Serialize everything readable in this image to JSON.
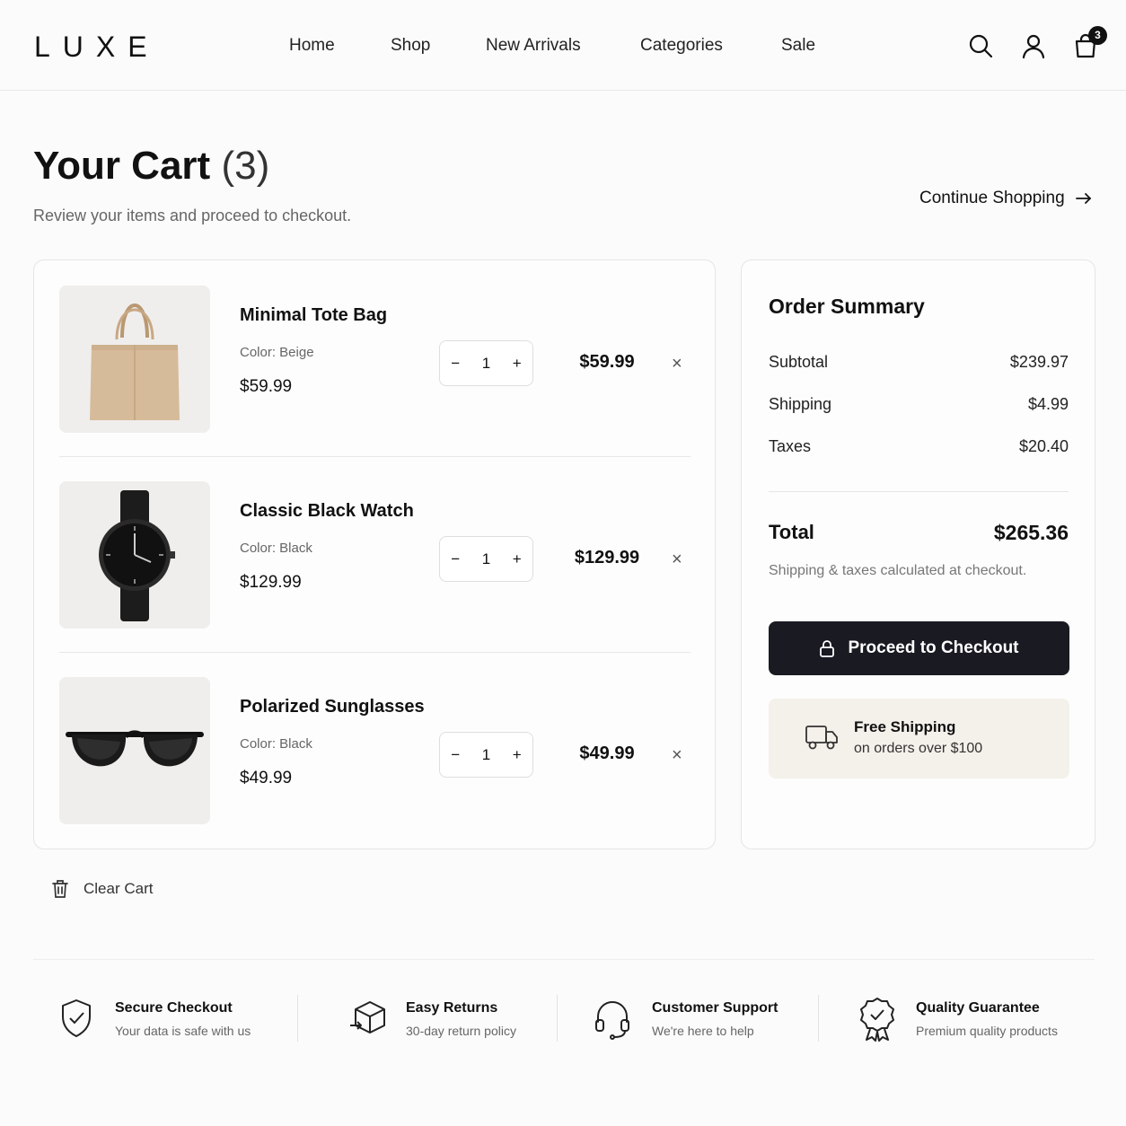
{
  "brand": {
    "logo": "LUXE"
  },
  "nav": {
    "items": [
      "Home",
      "Shop",
      "New Arrivals",
      "Categories",
      "Sale"
    ]
  },
  "header": {
    "cart_count": "3",
    "icons": [
      "search-icon",
      "user-icon",
      "shopping-bag-icon"
    ]
  },
  "page": {
    "title": "Your Cart",
    "title_count": "(3)",
    "subtitle": "Review your items and proceed to checkout.",
    "continue_label": "Continue Shopping"
  },
  "cart": {
    "items": [
      {
        "name": "Minimal Tote Bag",
        "color": "Color: Beige",
        "price": "$59.99",
        "qty": "1",
        "total": "$59.99",
        "image": "tote-bag-image"
      },
      {
        "name": "Classic Black Watch",
        "color": "Color: Black",
        "price": "$129.99",
        "qty": "1",
        "total": "$129.99",
        "image": "watch-image"
      },
      {
        "name": "Polarized Sunglasses",
        "color": "Color: Black",
        "price": "$49.99",
        "qty": "1",
        "total": "$49.99",
        "image": "sunglasses-image"
      }
    ],
    "qty_minus": "−",
    "qty_plus": "+",
    "remove": "×",
    "clear_label": "Clear Cart"
  },
  "summary": {
    "title": "Order Summary",
    "subtotal_label": "Subtotal",
    "subtotal": "$239.97",
    "shipping_label": "Shipping",
    "shipping": "$4.99",
    "taxes_label": "Taxes",
    "taxes": "$20.40",
    "total_label": "Total",
    "total": "$265.36",
    "note": "Shipping & taxes calculated at checkout.",
    "checkout_label": "Proceed to Checkout",
    "free_title": "Free Shipping",
    "free_sub": "on orders over $100"
  },
  "features": [
    {
      "title": "Secure Checkout",
      "sub": "Your data is safe with us",
      "icon": "shield-check-icon"
    },
    {
      "title": "Easy Returns",
      "sub": "30-day return policy",
      "icon": "box-return-icon"
    },
    {
      "title": "Customer Support",
      "sub": "We're here to help",
      "icon": "headset-icon"
    },
    {
      "title": "Quality Guarantee",
      "sub": "Premium quality products",
      "icon": "award-badge-icon"
    }
  ],
  "colors": {
    "primary": "#191a22",
    "accent_bg": "#f4f0ea",
    "image_bg": "#efeeec",
    "tote": "#d6bb9a"
  }
}
